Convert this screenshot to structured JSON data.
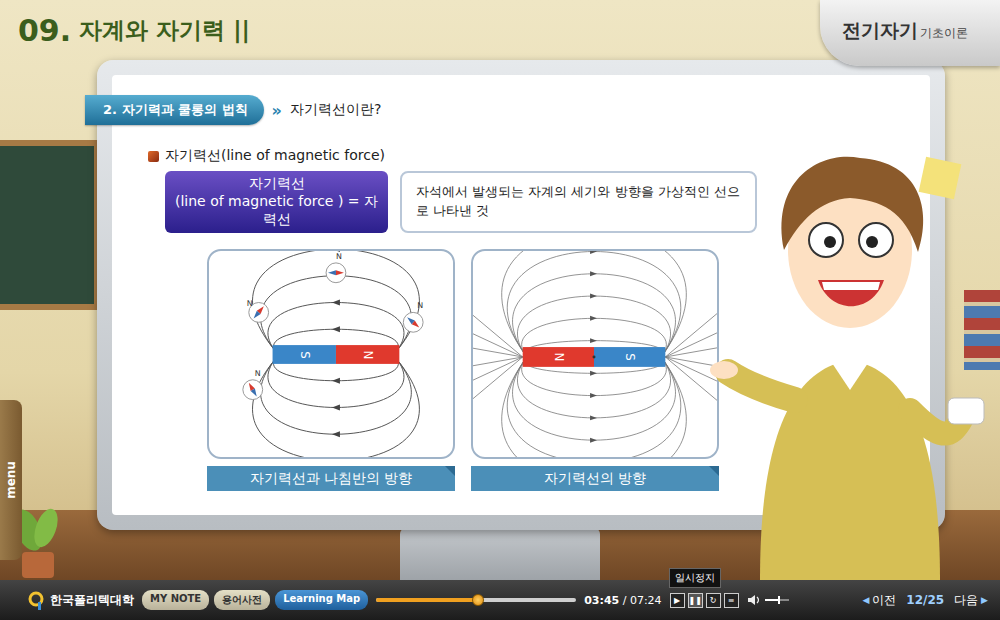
{
  "header": {
    "number": "09.",
    "title": "자계와 자기력 ||"
  },
  "badge": {
    "title": "전기자기",
    "subtitle": "기초이론"
  },
  "side_menu": {
    "label": "menu"
  },
  "breadcrumb": {
    "section": "2. 자기력과 쿨롱의 법칙",
    "separator": "»",
    "page": "자기력선이란?"
  },
  "heading": "자기력선(line of magnetic force)",
  "term": {
    "name": "자기력선",
    "detail": "(line of magnetic force ) = 자력선",
    "definition": "자석에서 발생되는 자계의 세기와 방향을 가상적인 선으로 나타낸 것"
  },
  "figures": [
    {
      "caption": "자기력선과 나침반의 방향",
      "kind": "compass",
      "poles": [
        {
          "label": "S",
          "color": "#3a86c8"
        },
        {
          "label": "N",
          "color": "#e0392d"
        }
      ],
      "compasses": [
        "N",
        "N",
        "N",
        "N"
      ]
    },
    {
      "caption": "자기력선의 방향",
      "kind": "field",
      "poles": [
        {
          "label": "N",
          "color": "#e0392d"
        },
        {
          "label": "S",
          "color": "#3a86c8"
        }
      ],
      "compasses": []
    }
  ],
  "player": {
    "logo": "한국폴리텍대학",
    "buttons": [
      {
        "label": "MY NOTE",
        "kind": "plain"
      },
      {
        "label": "용어사전",
        "kind": "plain"
      },
      {
        "label": "Learning Map",
        "kind": "primary"
      }
    ],
    "progress": {
      "level": 0.51
    },
    "time": {
      "current": "03:45",
      "separator": "/",
      "total": "07:24"
    },
    "controls": [
      {
        "icon": "▶",
        "hovered": false
      },
      {
        "icon": "❚❚",
        "hovered": true,
        "tooltip": "일시정지"
      },
      {
        "icon": "↻",
        "hovered": false
      },
      {
        "icon": "≡",
        "hovered": false
      }
    ],
    "volume": {
      "level": 0.6
    },
    "prev": {
      "icon": "◀",
      "label": "이전"
    },
    "page": "12/25",
    "next": {
      "label": "다음",
      "icon": "▶"
    }
  }
}
